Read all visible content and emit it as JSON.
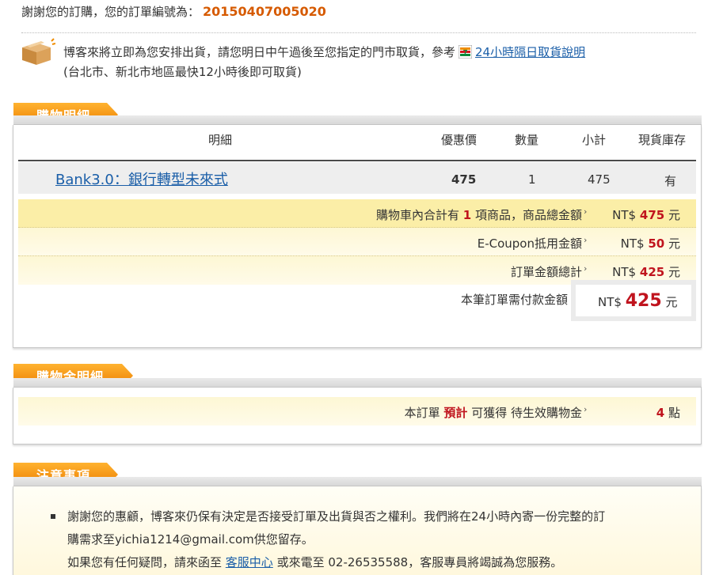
{
  "header": {
    "thanks_text": "謝謝您的訂購，您的訂單編號為：",
    "order_number": "20150407005020"
  },
  "shipping": {
    "line1_text": "博客來將立即為您安排出貨，請您明日中午過後至您指定的門市取貨，參考",
    "store_icon": "seven-eleven-icon",
    "pickup_link": "24小時隔日取貨說明",
    "line2_text": "(台北市、新北市地區最快12小時後即可取貨)"
  },
  "purchase": {
    "tab_label": "購物明細",
    "columns": {
      "detail": "明細",
      "price": "優惠價",
      "qty": "數量",
      "subtotal": "小計",
      "stock": "現貨庫存"
    },
    "items": [
      {
        "name": "Bank3.0：銀行轉型未來式",
        "price": "475",
        "qty": "1",
        "subtotal": "475",
        "stock": "有"
      }
    ],
    "cart_prefix": "購物車內合計有",
    "cart_count": "1",
    "cart_suffix": "項商品，商品總金額",
    "cart_currency": "NT$",
    "cart_amount": "475",
    "cart_unit": "元",
    "coupon_label": "E-Coupon抵用金額",
    "coupon_currency": "NT$",
    "coupon_amount": "50",
    "coupon_unit": "元",
    "total_label": "訂單金額總計",
    "total_currency": "NT$",
    "total_amount": "425",
    "total_unit": "元",
    "pay_label": "本筆訂單需付款金額",
    "pay_currency": "NT$",
    "pay_amount": "425",
    "pay_unit": "元",
    "arrow": "›"
  },
  "points": {
    "tab_label": "購物金明細",
    "text_prefix": "本訂單",
    "text_highlight": "預計",
    "text_suffix": "可獲得 待生效購物金",
    "arrow": "›",
    "amount": "4",
    "unit": "點"
  },
  "notes": {
    "tab_label": "注意事項",
    "line1": "謝謝您的惠顧，博客來仍保有決定是否接受訂單及出貨與否之權利。我們將在24小時內寄一份完整的訂",
    "line2": "購需求至yichia1214@gmail.com供您留存。",
    "line3_prefix": "如果您有任何疑問，請來函至",
    "service_link": "客服中心",
    "line3_suffix": "或來電至 02-26535588，客服專員將竭誠為您服務。"
  },
  "colors": {
    "tab_orange": "#f08c00",
    "order_number": "#d65a00",
    "price_red": "#c0141e",
    "link_blue": "#1a5ea8",
    "summary_yellow": "#fbeea7"
  }
}
